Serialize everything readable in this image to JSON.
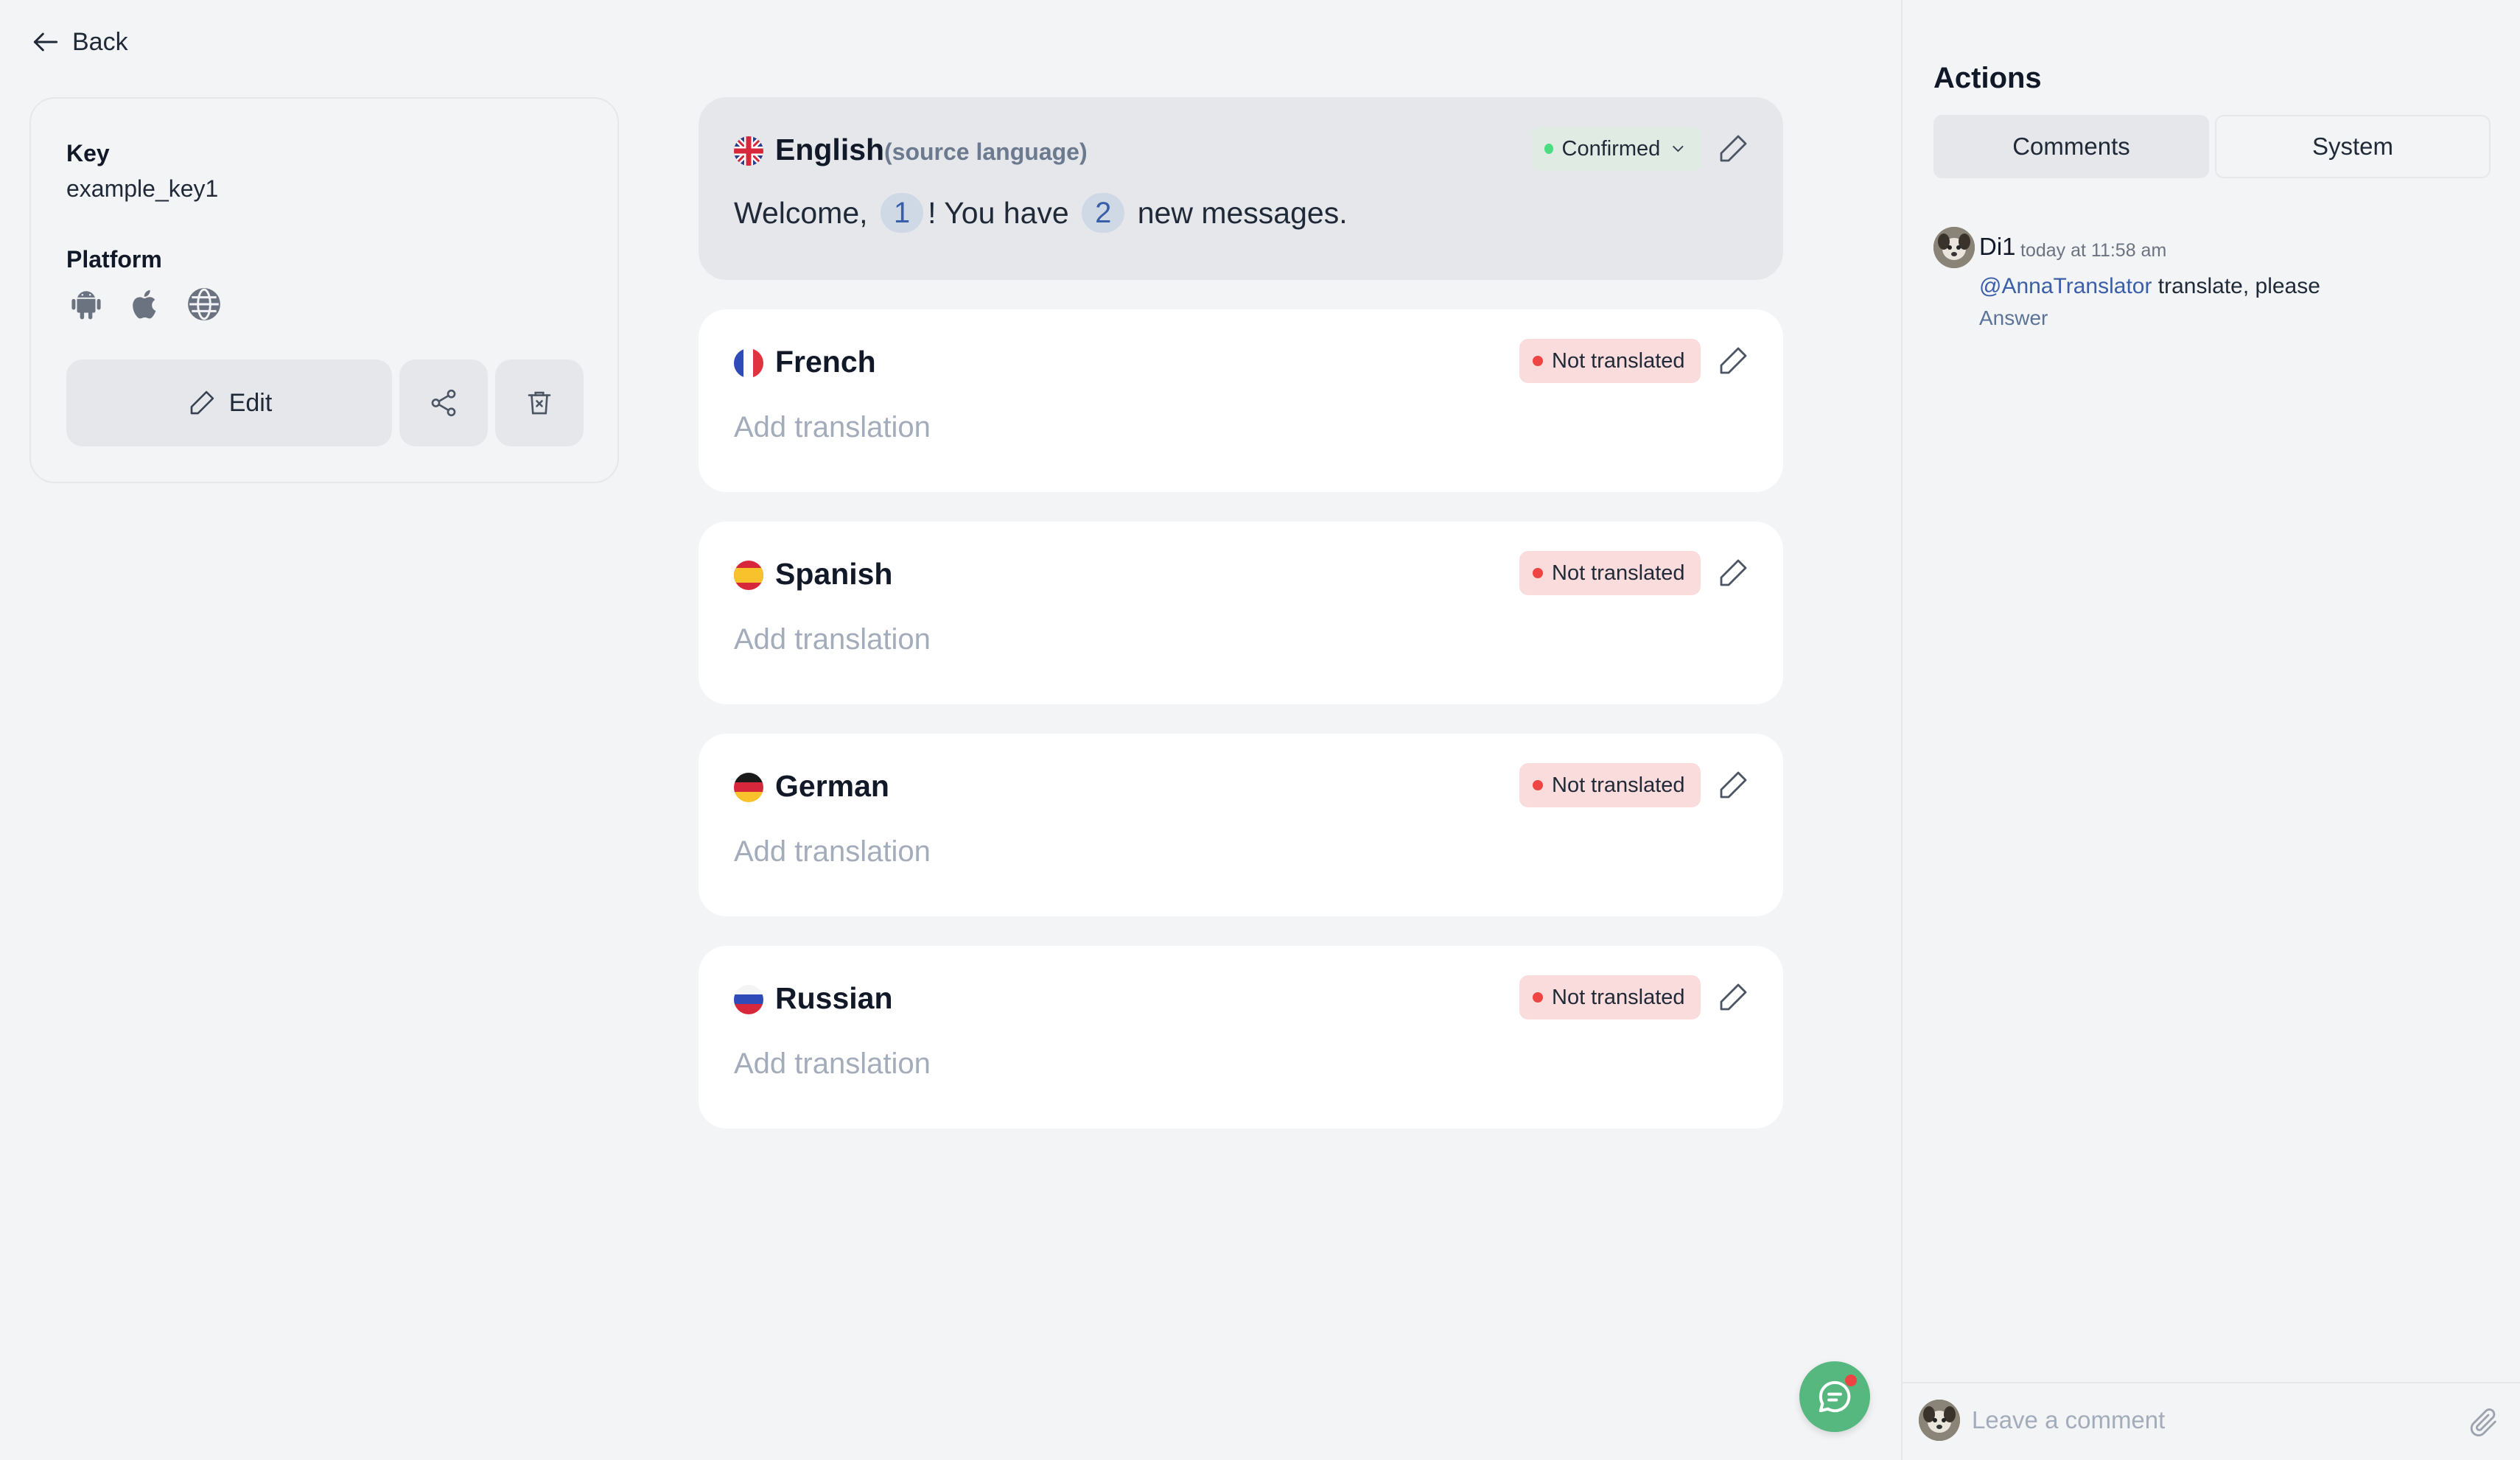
{
  "nav": {
    "back_label": "Back"
  },
  "key_info": {
    "key_label": "Key",
    "key_value": "example_key1",
    "platform_label": "Platform",
    "platforms": [
      "android-icon",
      "apple-icon",
      "globe-icon"
    ],
    "edit_label": "Edit"
  },
  "source": {
    "language": "English",
    "sub_label": "(source language)",
    "status": "Confirmed",
    "text_parts": [
      "Welcome, ",
      "1",
      "! You have ",
      "2",
      " new messages."
    ]
  },
  "targets": [
    {
      "language": "French",
      "status": "Not translated",
      "placeholder": "Add translation"
    },
    {
      "language": "Spanish",
      "status": "Not translated",
      "placeholder": "Add translation"
    },
    {
      "language": "German",
      "status": "Not translated",
      "placeholder": "Add translation"
    },
    {
      "language": "Russian",
      "status": "Not translated",
      "placeholder": "Add translation"
    }
  ],
  "actions": {
    "title": "Actions",
    "tabs": [
      {
        "label": "Comments",
        "active": true
      },
      {
        "label": "System",
        "active": false
      }
    ],
    "comment": {
      "author": "Di1",
      "time": "today at 11:58 am",
      "mention": "@AnnaTranslator",
      "text": " translate, please",
      "answer_label": "Answer"
    },
    "input_placeholder": "Leave a comment"
  },
  "colors": {
    "background": "#f3f4f6",
    "confirmed_dot": "#4ade80",
    "not_translated_bg": "#fbdcdc",
    "not_translated_dot": "#ef4444",
    "link": "#3b5ea8",
    "chat_fab": "#56b77f"
  }
}
